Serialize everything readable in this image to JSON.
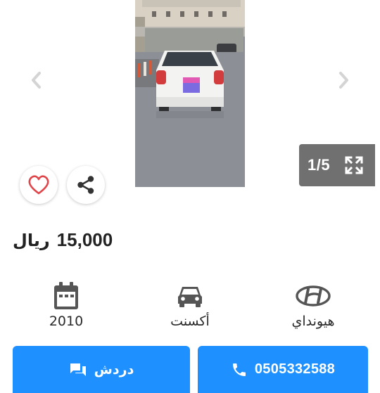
{
  "gallery": {
    "counter": "1/5",
    "icons": {
      "prev": "chevron-left-icon",
      "next": "chevron-right-icon",
      "fullscreen": "fullscreen-icon"
    }
  },
  "actions": {
    "favorite_icon": "heart-icon",
    "share_icon": "share-icon",
    "favorite_color": "#e0454a"
  },
  "listing": {
    "price_amount": "15,000",
    "price_currency": "ريال"
  },
  "specs": [
    {
      "icon": "calendar-icon",
      "label": "2010"
    },
    {
      "icon": "car-icon",
      "label": "أكسنت"
    },
    {
      "icon": "hyundai-logo",
      "label": "هيونداي"
    }
  ],
  "buttons": {
    "chat_label": "دردش",
    "call_label": "0505332588",
    "color": "#1e90ff"
  }
}
